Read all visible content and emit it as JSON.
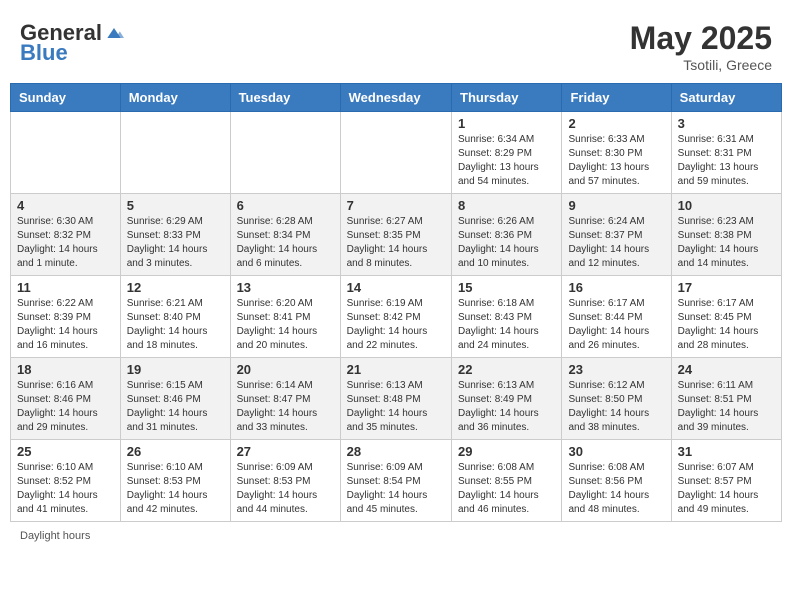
{
  "header": {
    "logo_general": "General",
    "logo_blue": "Blue",
    "month_year": "May 2025",
    "location": "Tsotili, Greece"
  },
  "footer": {
    "daylight_label": "Daylight hours"
  },
  "days_of_week": [
    "Sunday",
    "Monday",
    "Tuesday",
    "Wednesday",
    "Thursday",
    "Friday",
    "Saturday"
  ],
  "weeks": [
    [
      {
        "day": "",
        "info": ""
      },
      {
        "day": "",
        "info": ""
      },
      {
        "day": "",
        "info": ""
      },
      {
        "day": "",
        "info": ""
      },
      {
        "day": "1",
        "info": "Sunrise: 6:34 AM\nSunset: 8:29 PM\nDaylight: 13 hours\nand 54 minutes."
      },
      {
        "day": "2",
        "info": "Sunrise: 6:33 AM\nSunset: 8:30 PM\nDaylight: 13 hours\nand 57 minutes."
      },
      {
        "day": "3",
        "info": "Sunrise: 6:31 AM\nSunset: 8:31 PM\nDaylight: 13 hours\nand 59 minutes."
      }
    ],
    [
      {
        "day": "4",
        "info": "Sunrise: 6:30 AM\nSunset: 8:32 PM\nDaylight: 14 hours\nand 1 minute."
      },
      {
        "day": "5",
        "info": "Sunrise: 6:29 AM\nSunset: 8:33 PM\nDaylight: 14 hours\nand 3 minutes."
      },
      {
        "day": "6",
        "info": "Sunrise: 6:28 AM\nSunset: 8:34 PM\nDaylight: 14 hours\nand 6 minutes."
      },
      {
        "day": "7",
        "info": "Sunrise: 6:27 AM\nSunset: 8:35 PM\nDaylight: 14 hours\nand 8 minutes."
      },
      {
        "day": "8",
        "info": "Sunrise: 6:26 AM\nSunset: 8:36 PM\nDaylight: 14 hours\nand 10 minutes."
      },
      {
        "day": "9",
        "info": "Sunrise: 6:24 AM\nSunset: 8:37 PM\nDaylight: 14 hours\nand 12 minutes."
      },
      {
        "day": "10",
        "info": "Sunrise: 6:23 AM\nSunset: 8:38 PM\nDaylight: 14 hours\nand 14 minutes."
      }
    ],
    [
      {
        "day": "11",
        "info": "Sunrise: 6:22 AM\nSunset: 8:39 PM\nDaylight: 14 hours\nand 16 minutes."
      },
      {
        "day": "12",
        "info": "Sunrise: 6:21 AM\nSunset: 8:40 PM\nDaylight: 14 hours\nand 18 minutes."
      },
      {
        "day": "13",
        "info": "Sunrise: 6:20 AM\nSunset: 8:41 PM\nDaylight: 14 hours\nand 20 minutes."
      },
      {
        "day": "14",
        "info": "Sunrise: 6:19 AM\nSunset: 8:42 PM\nDaylight: 14 hours\nand 22 minutes."
      },
      {
        "day": "15",
        "info": "Sunrise: 6:18 AM\nSunset: 8:43 PM\nDaylight: 14 hours\nand 24 minutes."
      },
      {
        "day": "16",
        "info": "Sunrise: 6:17 AM\nSunset: 8:44 PM\nDaylight: 14 hours\nand 26 minutes."
      },
      {
        "day": "17",
        "info": "Sunrise: 6:17 AM\nSunset: 8:45 PM\nDaylight: 14 hours\nand 28 minutes."
      }
    ],
    [
      {
        "day": "18",
        "info": "Sunrise: 6:16 AM\nSunset: 8:46 PM\nDaylight: 14 hours\nand 29 minutes."
      },
      {
        "day": "19",
        "info": "Sunrise: 6:15 AM\nSunset: 8:46 PM\nDaylight: 14 hours\nand 31 minutes."
      },
      {
        "day": "20",
        "info": "Sunrise: 6:14 AM\nSunset: 8:47 PM\nDaylight: 14 hours\nand 33 minutes."
      },
      {
        "day": "21",
        "info": "Sunrise: 6:13 AM\nSunset: 8:48 PM\nDaylight: 14 hours\nand 35 minutes."
      },
      {
        "day": "22",
        "info": "Sunrise: 6:13 AM\nSunset: 8:49 PM\nDaylight: 14 hours\nand 36 minutes."
      },
      {
        "day": "23",
        "info": "Sunrise: 6:12 AM\nSunset: 8:50 PM\nDaylight: 14 hours\nand 38 minutes."
      },
      {
        "day": "24",
        "info": "Sunrise: 6:11 AM\nSunset: 8:51 PM\nDaylight: 14 hours\nand 39 minutes."
      }
    ],
    [
      {
        "day": "25",
        "info": "Sunrise: 6:10 AM\nSunset: 8:52 PM\nDaylight: 14 hours\nand 41 minutes."
      },
      {
        "day": "26",
        "info": "Sunrise: 6:10 AM\nSunset: 8:53 PM\nDaylight: 14 hours\nand 42 minutes."
      },
      {
        "day": "27",
        "info": "Sunrise: 6:09 AM\nSunset: 8:53 PM\nDaylight: 14 hours\nand 44 minutes."
      },
      {
        "day": "28",
        "info": "Sunrise: 6:09 AM\nSunset: 8:54 PM\nDaylight: 14 hours\nand 45 minutes."
      },
      {
        "day": "29",
        "info": "Sunrise: 6:08 AM\nSunset: 8:55 PM\nDaylight: 14 hours\nand 46 minutes."
      },
      {
        "day": "30",
        "info": "Sunrise: 6:08 AM\nSunset: 8:56 PM\nDaylight: 14 hours\nand 48 minutes."
      },
      {
        "day": "31",
        "info": "Sunrise: 6:07 AM\nSunset: 8:57 PM\nDaylight: 14 hours\nand 49 minutes."
      }
    ]
  ]
}
